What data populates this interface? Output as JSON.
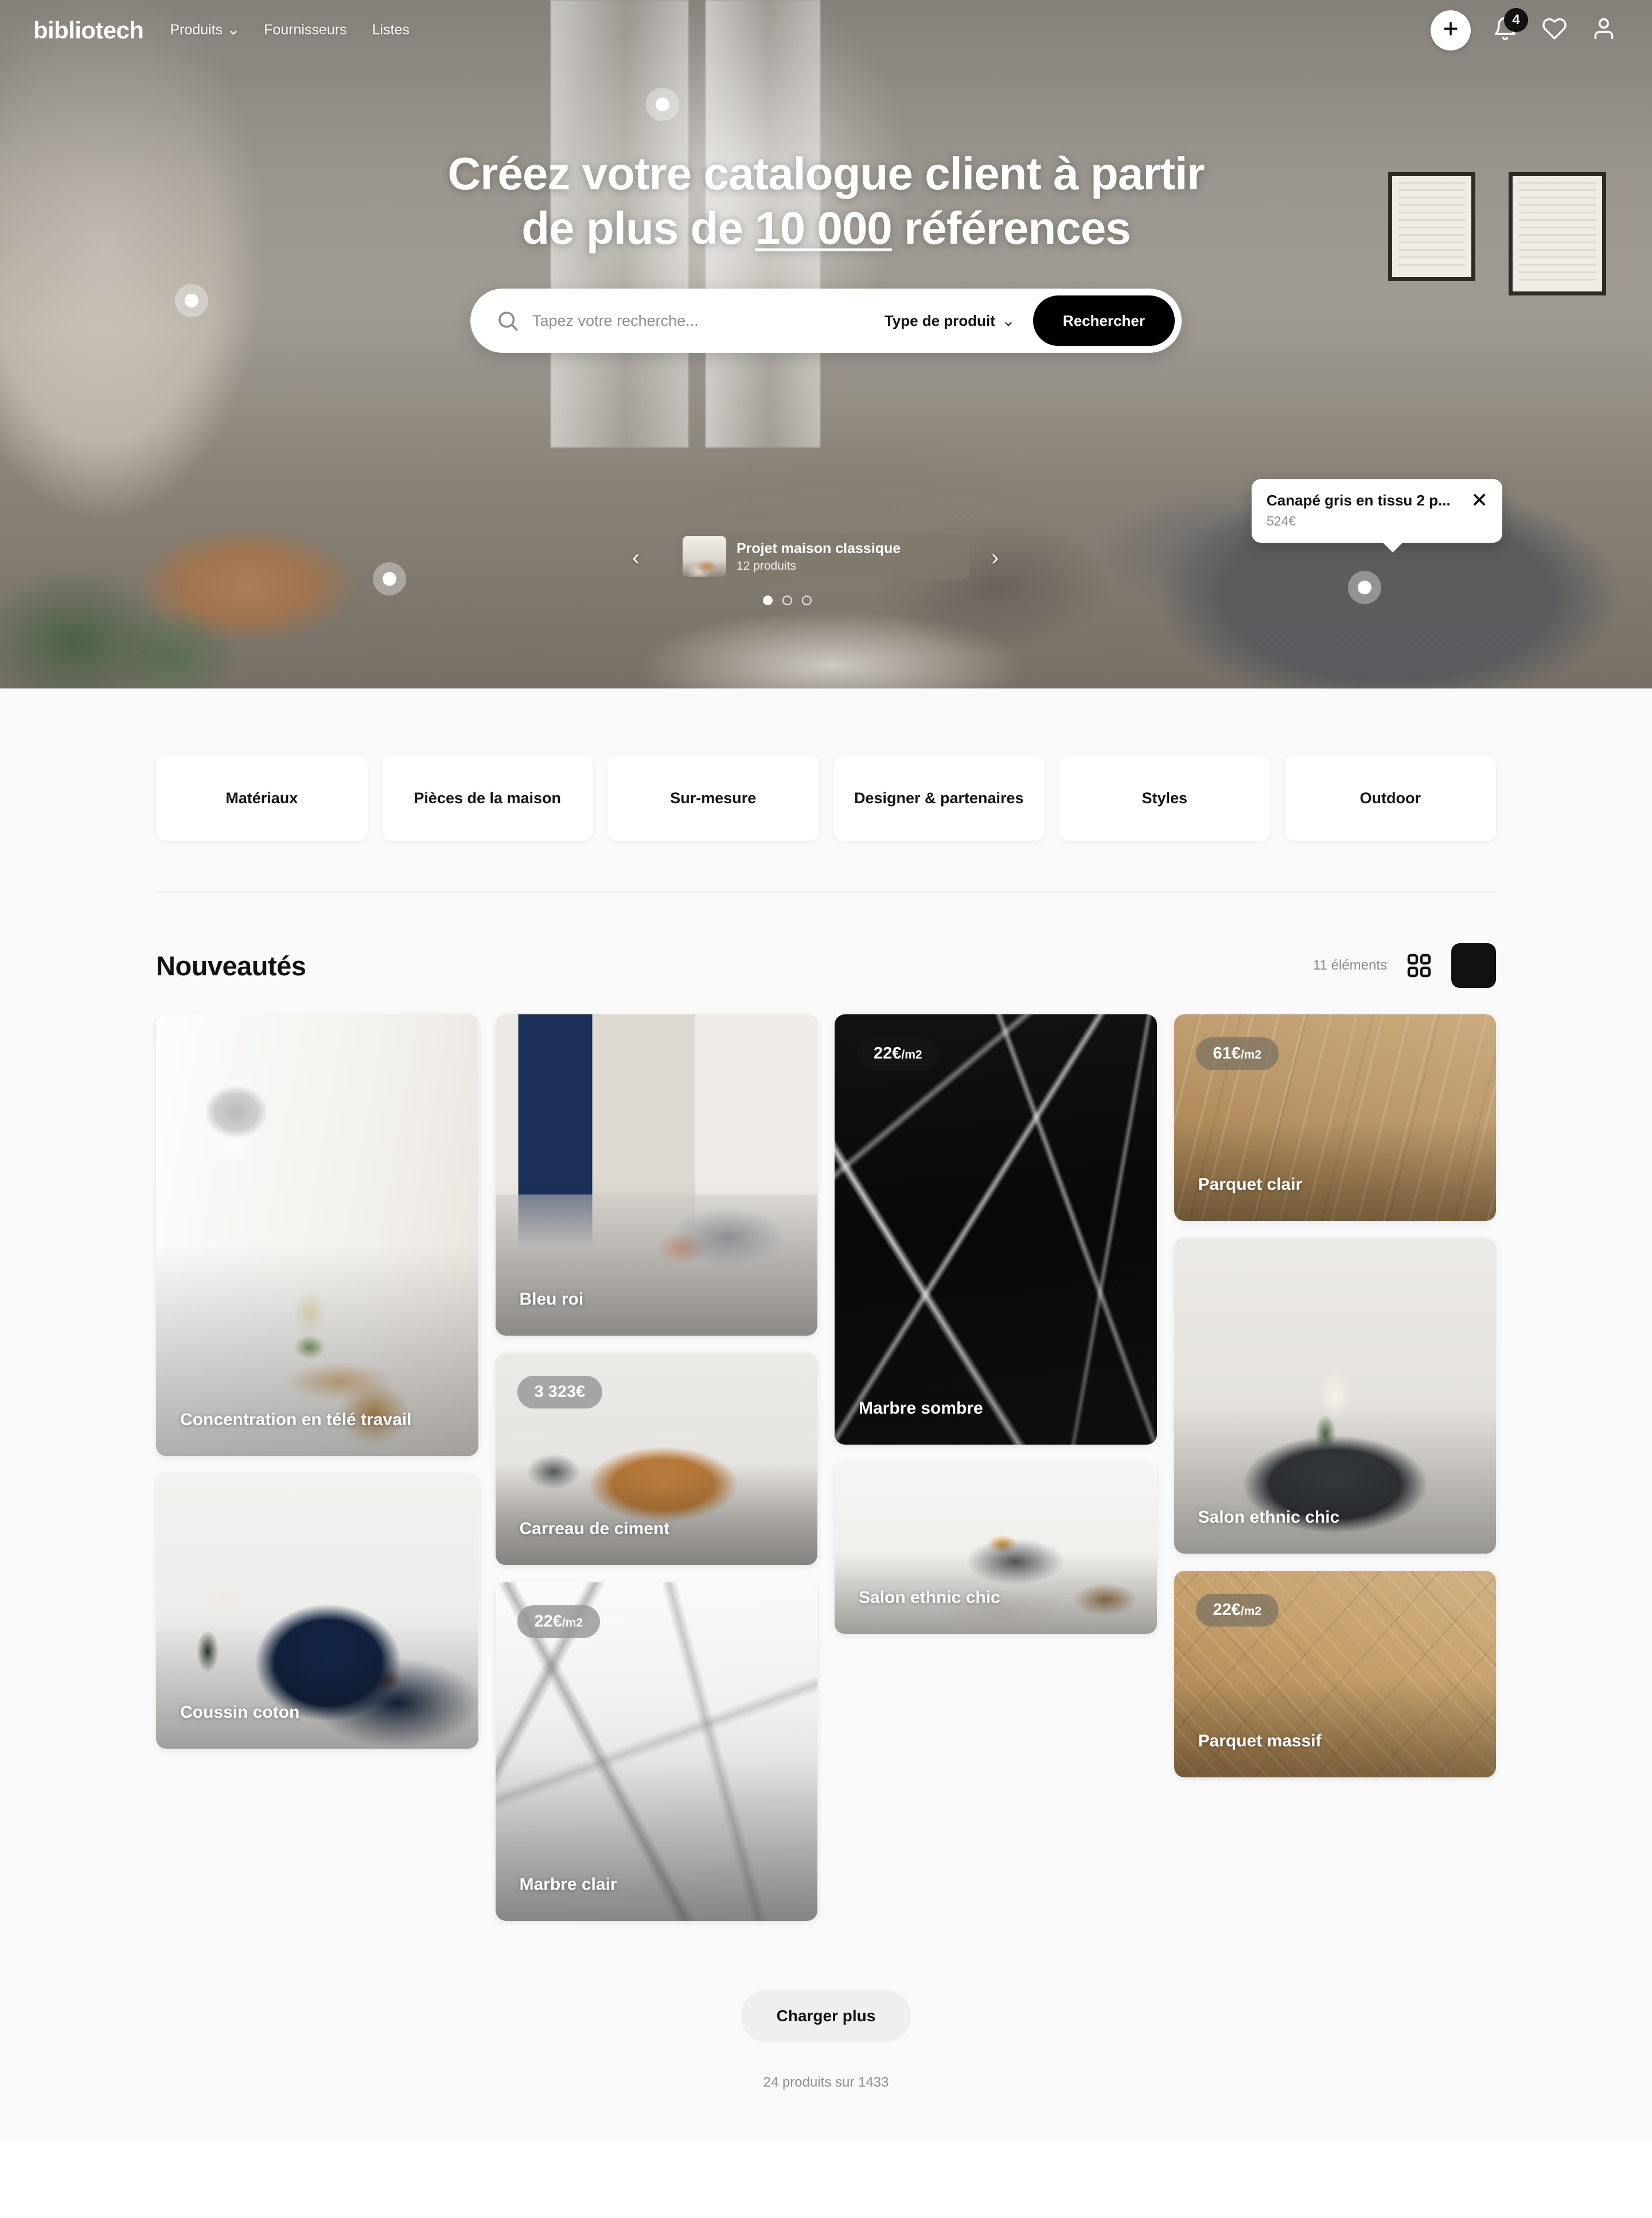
{
  "brand": "bibliotech",
  "nav": {
    "links": [
      {
        "label": "Produits",
        "has_chevron": true
      },
      {
        "label": "Fournisseurs",
        "has_chevron": false
      },
      {
        "label": "Listes",
        "has_chevron": false
      }
    ],
    "add_icon": "plus-icon",
    "bell_icon": "bell-icon",
    "notification_count": "4",
    "heart_icon": "heart-icon",
    "account_icon": "user-icon"
  },
  "hero": {
    "title_line1": "Créez votre catalogue client à partir",
    "title_line2_before": "de plus de ",
    "title_highlight": "10 000",
    "title_line2_after": " références",
    "search": {
      "placeholder": "Tapez votre recherche...",
      "value": "",
      "search_icon": "search-icon",
      "type_label": "Type de produit",
      "type_chevron": "chevron-down-icon",
      "button_label": "Rechercher"
    },
    "tooltip": {
      "title": "Canapé gris en tissu 2 p...",
      "price": "524€",
      "close_icon": "close-icon"
    },
    "carousel": {
      "title": "Projet maison classique",
      "subtitle": "12 produits",
      "prev_icon": "chevron-left-icon",
      "next_icon": "chevron-right-icon",
      "dots": 3,
      "active_dot": 0
    }
  },
  "categories": [
    {
      "label": "Matériaux"
    },
    {
      "label": "Pièces de la maison"
    },
    {
      "label": "Sur-mesure"
    },
    {
      "label": "Designer & partenaires"
    },
    {
      "label": "Styles"
    },
    {
      "label": "Outdoor"
    }
  ],
  "section": {
    "title": "Nouveautés",
    "count_label": "11 éléments",
    "view_grid_icon": "grid-view-icon",
    "view_large_icon": "large-view-icon"
  },
  "products": {
    "col1": [
      {
        "name": "Concentration en télé travail",
        "price": "",
        "unit": ""
      },
      {
        "name": "Coussin coton",
        "price": "",
        "unit": ""
      }
    ],
    "col2": [
      {
        "name": "Bleu roi",
        "price": "",
        "unit": ""
      },
      {
        "name": "Carreau de ciment",
        "price": "3 323€",
        "unit": ""
      },
      {
        "name": "Marbre clair",
        "price": "22€",
        "unit": "/m2"
      }
    ],
    "col3": [
      {
        "name": "Marbre sombre",
        "price": "22€",
        "unit": "/m2"
      },
      {
        "name": "Salon ethnic chic",
        "price": "",
        "unit": ""
      }
    ],
    "col4": [
      {
        "name": "Parquet clair",
        "price": "61€",
        "unit": "/m2"
      },
      {
        "name": "Salon ethnic chic",
        "price": "",
        "unit": ""
      },
      {
        "name": "Parquet massif",
        "price": "22€",
        "unit": "/m2"
      }
    ]
  },
  "footer": {
    "load_more_label": "Charger plus",
    "results_note": "24 produits sur 1433"
  },
  "colors": {
    "accent_black": "#000000",
    "page_bg": "#fafafa",
    "card_bg": "#ffffff",
    "muted_text": "#8e8e8e"
  }
}
